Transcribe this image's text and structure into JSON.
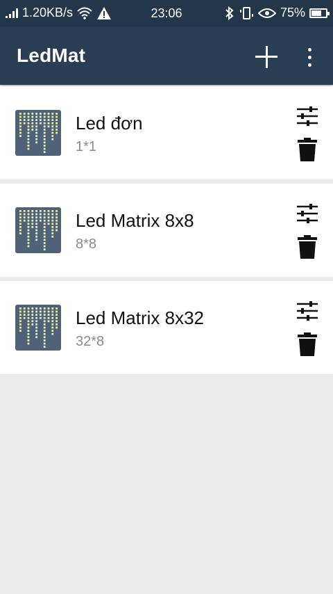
{
  "status_bar": {
    "net_speed": "1.20KB/s",
    "time": "23:06",
    "battery": "75%",
    "battery_level": 0.75,
    "icons": [
      "signal-icon",
      "wifi-icon",
      "warning-icon",
      "bluetooth-icon",
      "vibrate-icon",
      "eye-icon",
      "battery-icon"
    ]
  },
  "app_bar": {
    "title": "LedMat",
    "actions": [
      "add-icon",
      "more-vert-icon"
    ]
  },
  "devices": [
    {
      "name": "Led đơn",
      "size": "1*1"
    },
    {
      "name": "Led Matrix 8x8",
      "size": "8*8"
    },
    {
      "name": "Led Matrix 8x32",
      "size": "32*8"
    }
  ],
  "colors": {
    "status_bar_bg": "#24364a",
    "app_bar_bg": "#2b3d52",
    "page_bg": "#ececec",
    "card_bg": "#ffffff",
    "subtitle": "#8a8a8a",
    "thumb_bg": "#4f6278",
    "led_on": "#e6ecb0"
  }
}
